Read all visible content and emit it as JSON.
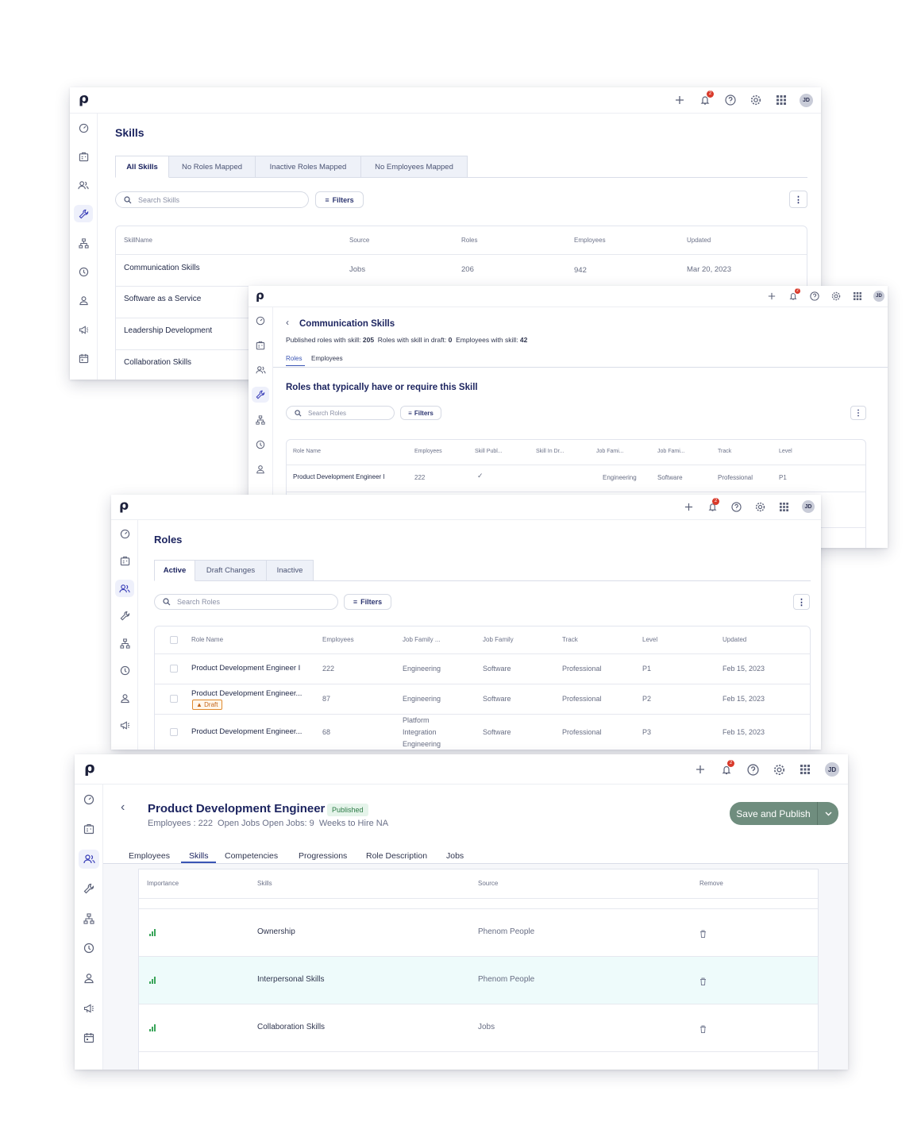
{
  "topbar": {
    "avatar_initials": "JD",
    "notif_count": "2"
  },
  "sidebar_icons": [
    "speedometer-icon",
    "badge-icon",
    "users-icon",
    "wrench-icon",
    "org-chart-icon",
    "clock-icon",
    "person-icon",
    "megaphone-icon",
    "calendar-icon"
  ],
  "skills": {
    "title": "Skills",
    "tabs": [
      "All Skills",
      "No Roles Mapped",
      "Inactive Roles Mapped",
      "No Employees Mapped"
    ],
    "search_placeholder": "Search Skills",
    "filters_label": "Filters",
    "columns": [
      "SkillName",
      "Source",
      "Roles",
      "Employees",
      "Updated"
    ],
    "rows": [
      {
        "name": "Communication Skills",
        "source": "Jobs",
        "roles": "206",
        "employees": "942",
        "updated": "Mar 20, 2023"
      },
      {
        "name": "Software as a Service"
      },
      {
        "name": "Leadership Development"
      },
      {
        "name": "Collaboration Skills"
      }
    ]
  },
  "comm": {
    "back": "‹",
    "title": "Communication Skills",
    "stats": {
      "published_label": "Published roles with skill:",
      "published_value": "205",
      "draft_label": "Roles with skill in draft:",
      "draft_value": "0",
      "employees_label": "Employees with skill:",
      "employees_value": "42"
    },
    "tabs": [
      "Roles",
      "Employees"
    ],
    "heading": "Roles that typically have or require this Skill",
    "search_placeholder": "Search Roles",
    "filters_label": "Filters",
    "columns": [
      "Role Name",
      "Employees",
      "Skill Publ...",
      "Skill In Dr...",
      "Job Fami...",
      "Job Fami...",
      "Track",
      "Level"
    ],
    "row": {
      "name": "Product Development Engineer I",
      "employees": "222",
      "check": "✓",
      "family": "Engineering",
      "sub_family": "Software",
      "track": "Professional",
      "level": "P1"
    }
  },
  "roles": {
    "title": "Roles",
    "tabs": [
      "Active",
      "Draft Changes",
      "Inactive"
    ],
    "search_placeholder": "Search Roles",
    "filters_label": "Filters",
    "columns": [
      "Role Name",
      "Employees",
      "Job Family ...",
      "Job Family",
      "Track",
      "Level",
      "Updated"
    ],
    "draft_label": "Draft",
    "rows": [
      {
        "name": "Product Development Engineer I",
        "employees": "222",
        "family": "Engineering",
        "sub_family": "Software",
        "track": "Professional",
        "level": "P1",
        "updated": "Feb 15, 2023"
      },
      {
        "name": "Product Development Engineer...",
        "employees": "87",
        "family": "Engineering",
        "sub_family": "Software",
        "track": "Professional",
        "level": "P2",
        "updated": "Feb 15, 2023"
      },
      {
        "name": "Product Development Engineer...",
        "employees": "68",
        "family_lines": [
          "Platform",
          "Integration",
          "Engineering"
        ],
        "sub_family": "Software",
        "track": "Professional",
        "level": "P3",
        "updated": "Feb 15, 2023"
      }
    ]
  },
  "pde": {
    "back": "‹",
    "title": "Product Development Engineer I",
    "status": "Published",
    "subtitle": "Employees : 222  Open Jobs Open Jobs: 9  Weeks to Hire NA",
    "save_label": "Save and Publish",
    "tabs": [
      "Employees",
      "Skills",
      "Competencies",
      "Progressions",
      "Role Description",
      "Jobs"
    ],
    "columns": [
      "Importance",
      "Skills",
      "Source",
      "Remove"
    ],
    "rows": [
      {
        "skill": "Ownership",
        "source": "Phenom People"
      },
      {
        "skill": "Interpersonal Skills",
        "source": "Phenom People"
      },
      {
        "skill": "Collaboration Skills",
        "source": "Jobs"
      }
    ]
  }
}
